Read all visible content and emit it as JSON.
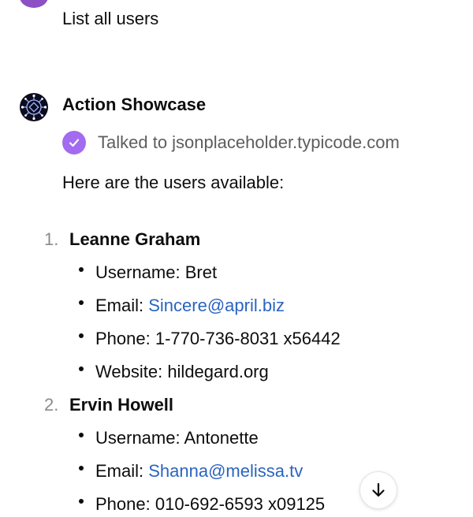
{
  "user_message": "List all users",
  "assistant": {
    "name": "Action Showcase",
    "action_status": "Talked to jsonplaceholder.typicode.com",
    "intro": "Here are the users available:"
  },
  "users": [
    {
      "number": "1.",
      "name": "Leanne Graham",
      "username_label": "Username:",
      "username": "Bret",
      "email_label": "Email:",
      "email": "Sincere@april.biz",
      "phone_label": "Phone:",
      "phone": "1-770-736-8031 x56442",
      "website_label": "Website:",
      "website": "hildegard.org"
    },
    {
      "number": "2.",
      "name": "Ervin Howell",
      "username_label": "Username:",
      "username": "Antonette",
      "email_label": "Email:",
      "email": "Shanna@melissa.tv",
      "phone_label": "Phone:",
      "phone": "010-692-6593 x09125"
    }
  ],
  "icons": {
    "user_avatar": "user-avatar",
    "assistant_avatar": "gear-circuit-icon",
    "action_check": "check-icon",
    "scroll_down": "arrow-down-icon"
  },
  "colors": {
    "link": "#2a64c0",
    "check_badge": "#a36bf0",
    "user_avatar": "#8c4fc4"
  }
}
